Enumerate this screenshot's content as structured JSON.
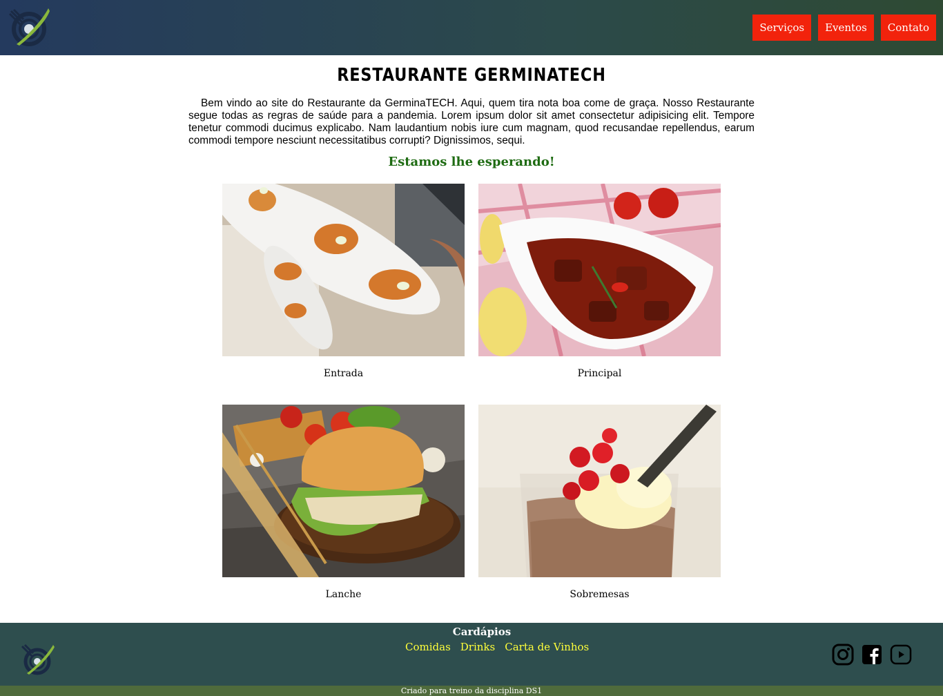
{
  "header": {
    "nav": [
      "Serviços",
      "Eventos",
      "Contato"
    ]
  },
  "main": {
    "title": "RESTAURANTE GERMINATECH",
    "intro": "Bem vindo ao site do Restaurante da GerminaTECH. Aqui, quem tira nota boa come de graça. Nosso Restaurante segue todas as regras de saúde para a pandemia. Lorem ipsum dolor sit amet consectetur adipisicing elit. Tempore tenetur commodi ducimus explicabo. Nam laudantium nobis iure cum magnam, quod recusandae repellendus, earum commodi tempore nesciunt necessitatibus corrupti? Dignissimos, sequi.",
    "subtitle": "Estamos lhe esperando!",
    "cards": [
      {
        "caption": "Entrada"
      },
      {
        "caption": "Principal"
      },
      {
        "caption": "Lanche"
      },
      {
        "caption": "Sobremesas"
      }
    ]
  },
  "footer": {
    "title": "Cardápios",
    "links": [
      "Comidas",
      "Drinks",
      "Carta de Vinhos"
    ],
    "social": [
      "instagram-icon",
      "facebook-icon",
      "youtube-icon"
    ],
    "credit": "Criado para treino da disciplina DS1"
  },
  "colors": {
    "nav_button": "#f2230c",
    "subtitle": "#1e6b12",
    "footer_bg": "#2e4e4e",
    "footer_link": "#ffff3a",
    "bottom_bar": "#4f6b3c"
  }
}
